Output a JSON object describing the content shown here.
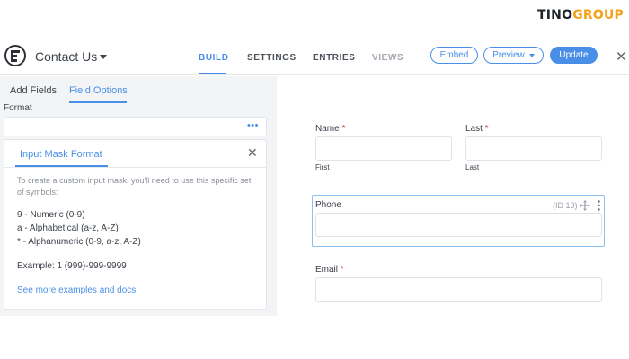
{
  "brand": {
    "part1": "TINO",
    "part2": "GROUP",
    "accent_color": "#f3a21a"
  },
  "header": {
    "form_title": "Contact Us",
    "tabs": [
      {
        "label": "BUILD",
        "active": true
      },
      {
        "label": "SETTINGS"
      },
      {
        "label": "ENTRIES"
      },
      {
        "label": "VIEWS",
        "disabled": true
      }
    ],
    "embed_label": "Embed",
    "preview_label": "Preview",
    "update_label": "Update",
    "accent_color": "#4a8fe7"
  },
  "sidebar": {
    "tabs": [
      {
        "label": "Add Fields"
      },
      {
        "label": "Field Options",
        "active": true
      }
    ],
    "format_label": "Format",
    "format_value": "",
    "mask_panel": {
      "title": "Input Mask Format",
      "description": "To create a custom input mask, you'll need to use this specific set of symbols:",
      "symbols": [
        "9 - Numeric (0-9)",
        "a - Alphabetical (a-z, A-Z)",
        "* - Alphanumeric (0-9, a-z, A-Z)"
      ],
      "example": "Example: 1 (999)-999-9999",
      "link": "See more examples and docs"
    }
  },
  "form": {
    "name_label": "Name",
    "first_sublabel": "First",
    "last_label": "Last",
    "last_sublabel": "Last",
    "phone_label": "Phone",
    "phone_id": "(ID 19)",
    "email_label": "Email",
    "required_mark": "*"
  }
}
